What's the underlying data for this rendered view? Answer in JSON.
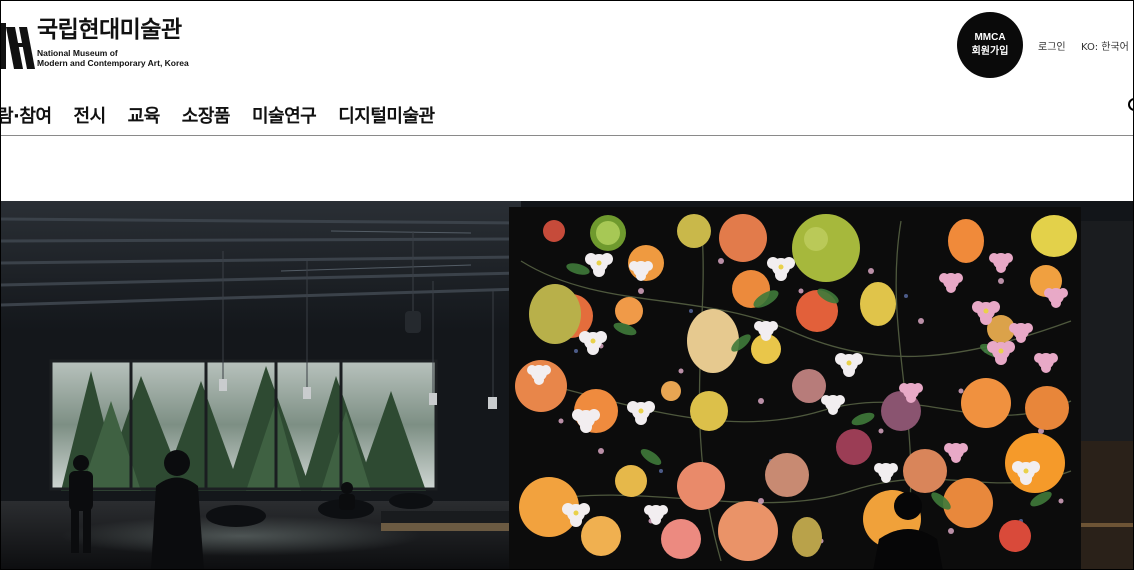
{
  "header": {
    "logo_ko": "국립현대미술관",
    "logo_en_line1": "National Museum of",
    "logo_en_line2": "Modern and Contemporary Art, Korea",
    "member": {
      "line1": "MMCA",
      "line2": "회원가입"
    },
    "login": "로그인",
    "language": "KO: 한국어"
  },
  "nav": {
    "items": [
      {
        "label": "람·참여"
      },
      {
        "label": "전시"
      },
      {
        "label": "교육"
      },
      {
        "label": "소장품"
      },
      {
        "label": "미술연구"
      },
      {
        "label": "디지털미술관"
      }
    ]
  },
  "icons": {
    "logo": "mmca-logo-icon",
    "search": "search-icon"
  },
  "colors": {
    "member_button": "#0a0a0a",
    "text": "#111111",
    "divider": "#8a8a8a",
    "hero_dark": "#15181c"
  }
}
